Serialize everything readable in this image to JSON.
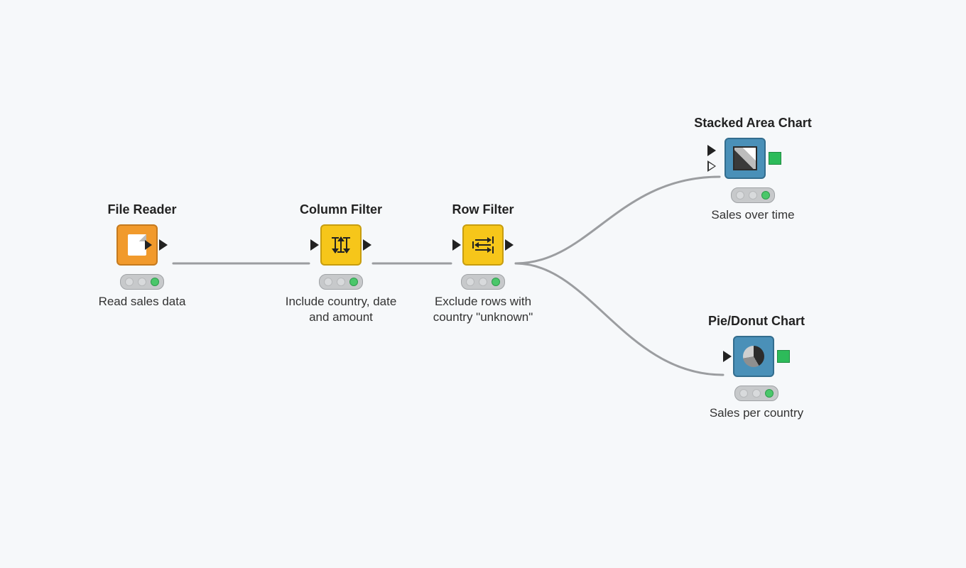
{
  "nodes": {
    "file": {
      "title": "File Reader",
      "desc": "Read sales data",
      "icon": "file-reader-icon",
      "color": "orange"
    },
    "col": {
      "title": "Column Filter",
      "desc": "Include country, date and amount",
      "icon": "column-filter-icon",
      "color": "yellow"
    },
    "row": {
      "title": "Row Filter",
      "desc": "Exclude rows with country \"unknown\"",
      "icon": "row-filter-icon",
      "color": "yellow"
    },
    "area": {
      "title": "Stacked Area Chart",
      "desc": "Sales over time",
      "icon": "stacked-area-chart-icon",
      "color": "blue"
    },
    "pie": {
      "title": "Pie/Donut Chart",
      "desc": "Sales per country",
      "icon": "pie-donut-chart-icon",
      "color": "blue"
    }
  },
  "status": {
    "state": "executed",
    "lights": [
      "off",
      "off",
      "green"
    ]
  },
  "connections": [
    {
      "from": "file",
      "to": "col"
    },
    {
      "from": "col",
      "to": "row"
    },
    {
      "from": "row",
      "to": "area"
    },
    {
      "from": "row",
      "to": "pie"
    }
  ],
  "colors": {
    "orange": "#f19a2c",
    "yellow": "#f6c61a",
    "blue": "#4a90b8",
    "green_port": "#2dbb5a",
    "status_green": "#4ac76a",
    "connection": "#9b9da0"
  }
}
